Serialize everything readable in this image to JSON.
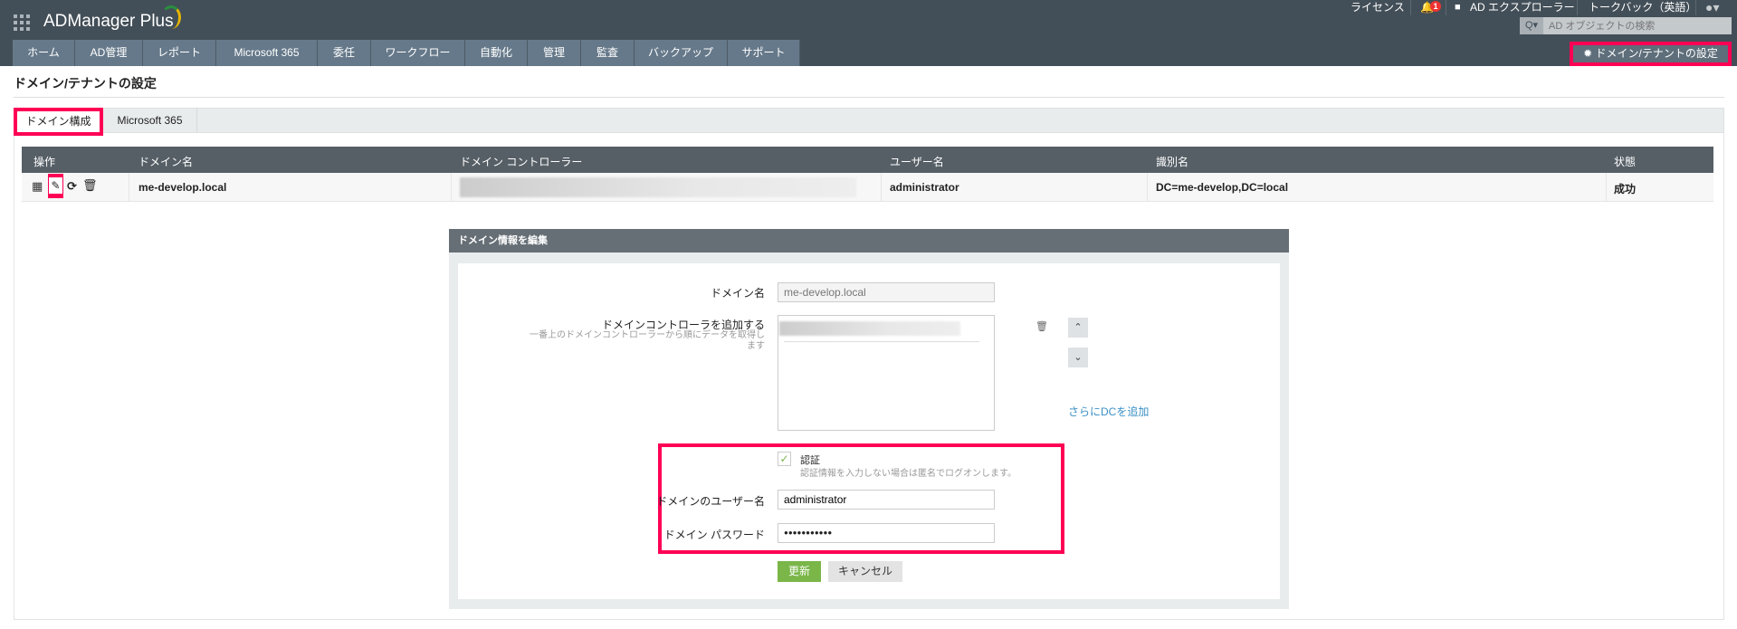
{
  "header": {
    "app_name": "ADManager Plus",
    "license": "ライセンス",
    "notification_count": "1",
    "ad_explorer": "AD エクスプローラー",
    "talkback": "トークバック（英語）",
    "search_placeholder": "AD オブジェクトの検索",
    "settings_button": "ドメイン/テナントの設定"
  },
  "nav": [
    "ホーム",
    "AD管理",
    "レポート",
    "Microsoft 365",
    "委任",
    "ワークフロー",
    "自動化",
    "管理",
    "監査",
    "バックアップ",
    "サポート"
  ],
  "page_title": "ドメイン/テナントの設定",
  "tabs": [
    "ドメイン構成",
    "Microsoft 365"
  ],
  "table": {
    "headers": [
      "操作",
      "ドメイン名",
      "ドメイン コントローラー",
      "ユーザー名",
      "識別名",
      "状態"
    ],
    "row": {
      "domain": "me-develop.local",
      "user": "administrator",
      "dn": "DC=me-develop,DC=local",
      "status": "成功"
    }
  },
  "edit": {
    "title": "ドメイン情報を編集",
    "domain_label": "ドメイン名",
    "domain_value": "me-develop.local",
    "dc_label": "ドメインコントローラを追加する",
    "dc_hint": "一番上のドメインコントローラーから順にデータを取得します",
    "add_dc": "さらにDCを追加",
    "auth_label": "認証",
    "auth_hint": "認証情報を入力しない場合は匿名でログオンします。",
    "auth_checked": true,
    "user_label": "ドメインのユーザー名",
    "user_value": "administrator",
    "password_label": "ドメイン パスワード",
    "password_value": "●●●●●●●●●●●",
    "update": "更新",
    "cancel": "キャンセル"
  },
  "colors": {
    "accent": "#ff0055",
    "green": "#7ab648",
    "header": "#434f58"
  }
}
